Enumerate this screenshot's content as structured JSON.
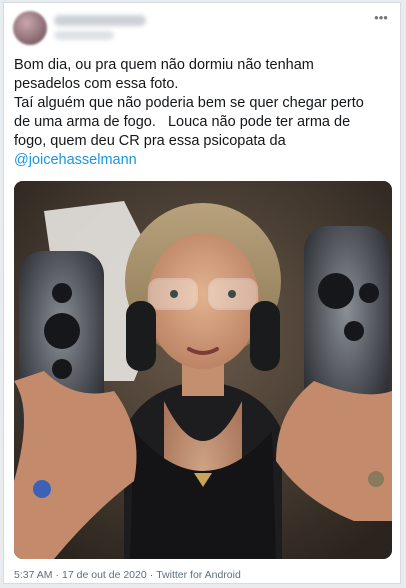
{
  "tweet": {
    "author_name": "",
    "author_handle": "",
    "more_icon": "more-dots-icon",
    "text_lines": [
      "Bom dia, ou pra quem não dormiu não tenham",
      "pesadelos com essa foto.",
      "Taí alguém que não poderia bem se quer chegar perto",
      "de uma arma de fogo.   Louca não pode ter arma de",
      "fogo, quem deu CR pra essa psicopata da"
    ],
    "mention": "@joicehasselmann",
    "time": "5:37 AM",
    "date": "17 de out de 2020",
    "source": "Twitter for Android",
    "separator": "·"
  },
  "colors": {
    "text": "#14171a",
    "mention": "#1b95e0",
    "meta": "#5b7083",
    "card_border": "#d6dbe0"
  }
}
